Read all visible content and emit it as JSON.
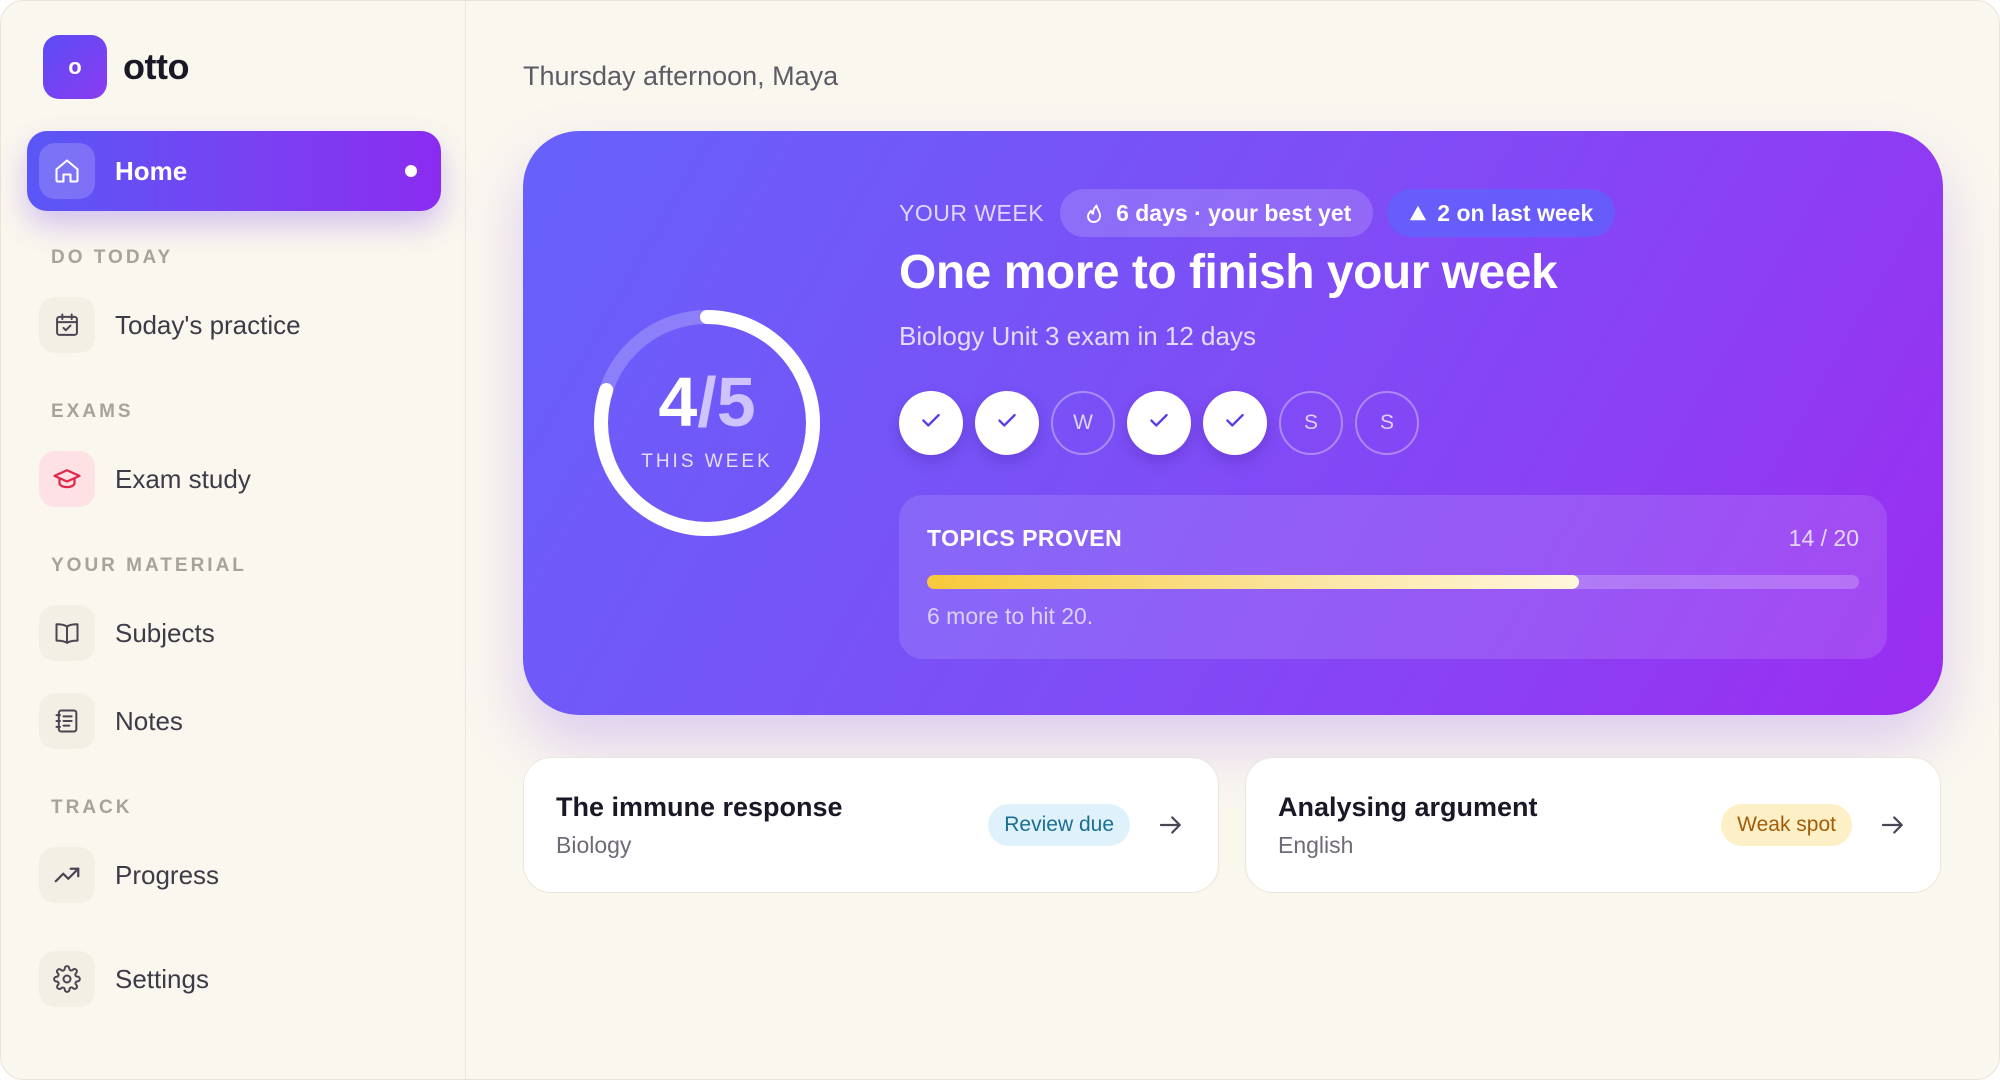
{
  "app": {
    "logo_letter": "o",
    "name": "otto"
  },
  "sidebar": {
    "home": {
      "label": "Home",
      "icon": "home-icon"
    },
    "sections": [
      {
        "label": "DO TODAY",
        "items": [
          {
            "label": "Today's practice",
            "icon": "calendar-check-icon"
          }
        ]
      },
      {
        "label": "EXAMS",
        "items": [
          {
            "label": "Exam study",
            "icon": "graduation-cap-icon"
          }
        ]
      },
      {
        "label": "YOUR MATERIAL",
        "items": [
          {
            "label": "Subjects",
            "icon": "book-icon"
          },
          {
            "label": "Notes",
            "icon": "notes-icon"
          }
        ]
      },
      {
        "label": "TRACK",
        "items": [
          {
            "label": "Progress",
            "icon": "trend-up-icon"
          }
        ]
      }
    ],
    "settings": {
      "label": "Settings",
      "icon": "gear-icon"
    }
  },
  "main": {
    "greeting": "Thursday afternoon, Maya",
    "hero": {
      "ring": {
        "done": "4",
        "total": "/5",
        "label": "THIS WEEK",
        "progress": 0.8
      },
      "week_label": "YOUR WEEK",
      "streak_pill": "6 days · your best yet",
      "delta_pill": "2 on last week",
      "title": "One more to finish your week",
      "subtitle": "Biology Unit 3 exam in 12 days",
      "days": [
        {
          "state": "done",
          "letter": ""
        },
        {
          "state": "done",
          "letter": ""
        },
        {
          "state": "todo",
          "letter": "W"
        },
        {
          "state": "done",
          "letter": ""
        },
        {
          "state": "done",
          "letter": ""
        },
        {
          "state": "todo",
          "letter": "S"
        },
        {
          "state": "todo",
          "letter": "S"
        }
      ],
      "topics": {
        "label": "TOPICS PROVEN",
        "count": "14 / 20",
        "progress": 0.7,
        "note": "6 more to hit 20."
      }
    },
    "cards": [
      {
        "title": "The immune response",
        "subject": "Biology",
        "badge": "Review due",
        "badge_type": "review"
      },
      {
        "title": "Analysing argument",
        "subject": "English",
        "badge": "Weak spot",
        "badge_type": "weak"
      }
    ]
  },
  "colors": {
    "accent": "#7b3ff2",
    "accent_start": "#5a57f6",
    "progress_bar": "#f7c93a",
    "background": "#faf7ef"
  }
}
